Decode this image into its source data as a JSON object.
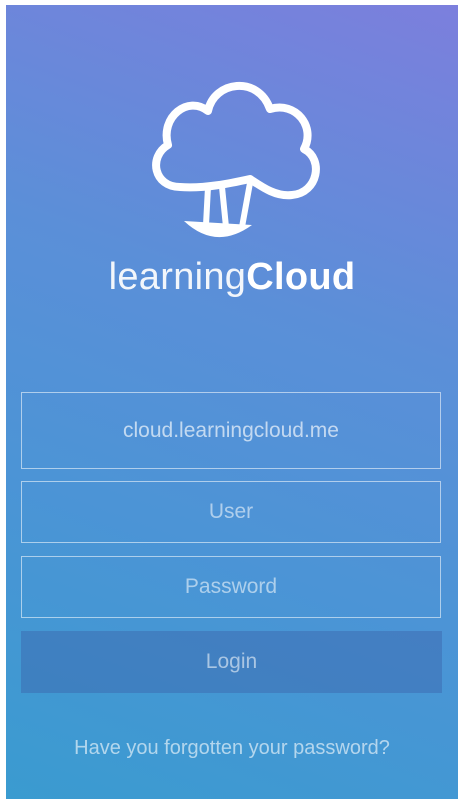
{
  "brand": {
    "name_light": "learning",
    "name_bold": "Cloud",
    "logo_icon": "cloud-balloon-icon"
  },
  "form": {
    "server_value": "cloud.learningcloud.me",
    "user_placeholder": "User",
    "password_placeholder": "Password",
    "login_label": "Login",
    "forgot_link": "Have you forgotten your password?"
  }
}
